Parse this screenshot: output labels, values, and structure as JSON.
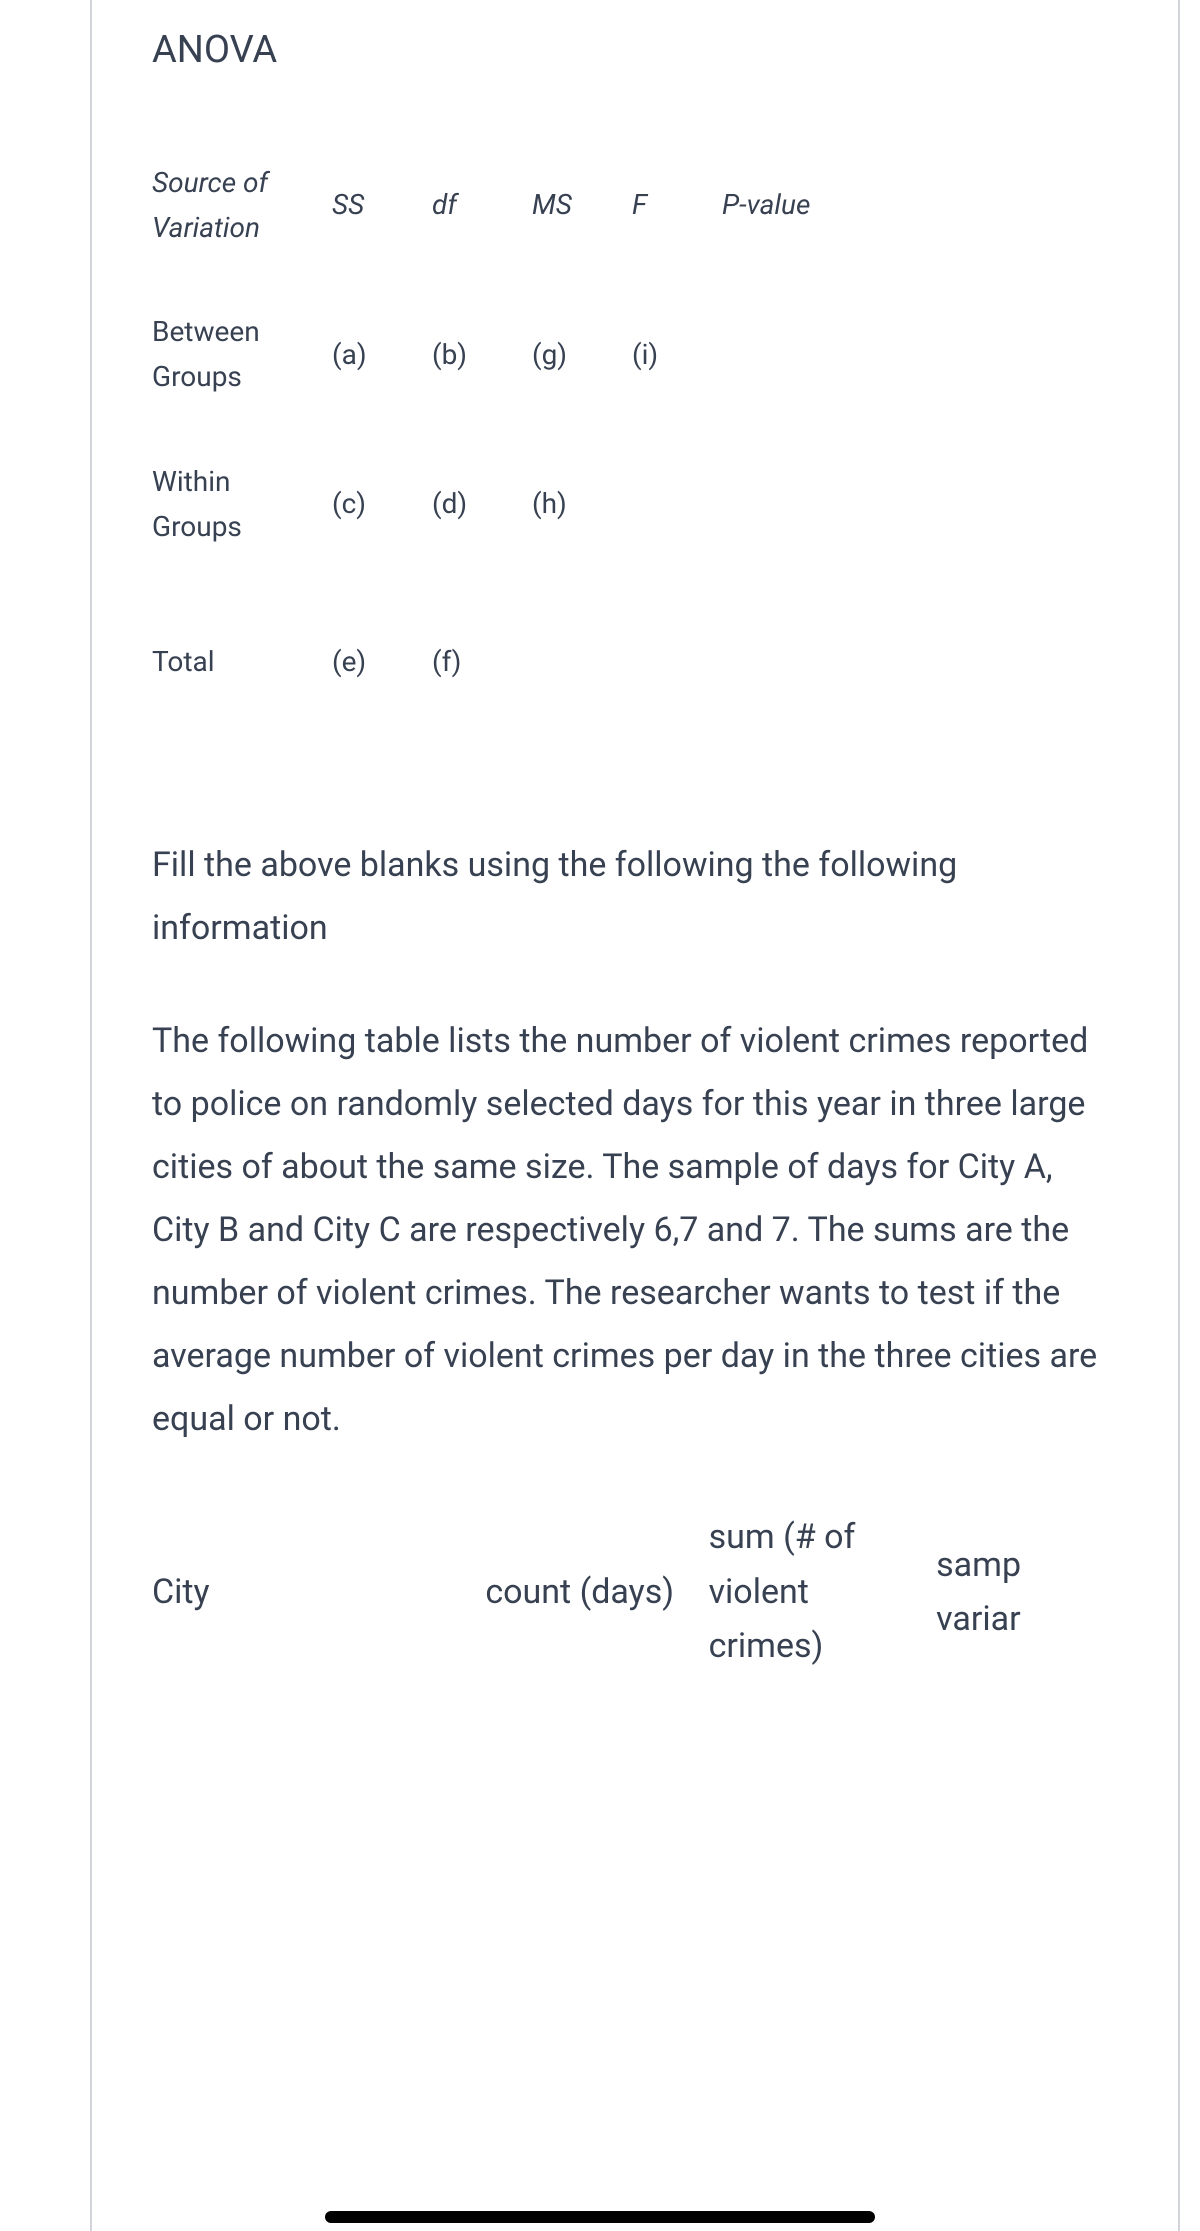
{
  "anova_title": "ANOVA",
  "anova_table": {
    "headers": {
      "source": "Source of Variation",
      "ss": "SS",
      "df": "df",
      "ms": "MS",
      "f": "F",
      "pvalue": "P-value"
    },
    "rows": {
      "between": {
        "label": "Between Groups",
        "ss": "(a)",
        "df": "(b)",
        "ms": "(g)",
        "f": "(i)"
      },
      "within": {
        "label": "Within Groups",
        "ss": "(c)",
        "df": "(d)",
        "ms": "(h)"
      },
      "total": {
        "label": "Total",
        "ss": "(e)",
        "df": "(f)"
      }
    }
  },
  "paragraph1": "Fill the above blanks using the following the following information",
  "paragraph2": "The following table lists the number of violent crimes reported to police on randomly selected days for this year in three large cities of about the same size.  The sample of days for City A, City B and City C are respectively 6,7 and 7. The sums are the number of violent crimes.  The researcher wants to test if the average number of violent crimes per day in the three cities are equal or not.",
  "data_table": {
    "headers": {
      "city": "City",
      "count": "count (days)",
      "sum": "sum (# of violent crimes)",
      "samp": "samp variar"
    }
  }
}
